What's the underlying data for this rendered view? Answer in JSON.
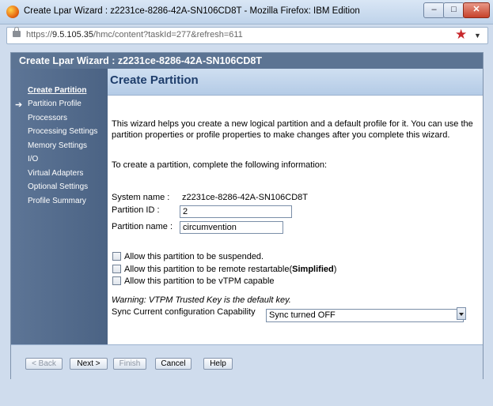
{
  "window": {
    "title": "Create Lpar Wizard : z2231ce-8286-42A-SN106CD8T - Mozilla Firefox: IBM Edition",
    "controls": {
      "minimize": "–",
      "maximize": "□",
      "close": "✕"
    }
  },
  "browser": {
    "url_prefix": "https://",
    "url_host": "9.5.105.35",
    "url_path": "/hmc/content?taskId=277&refresh=611"
  },
  "dialog": {
    "title": "Create Lpar Wizard : z2231ce-8286-42A-SN106CD8T"
  },
  "sidebar": {
    "items": [
      {
        "label": "Create Partition",
        "active": true
      },
      {
        "label": "Partition Profile"
      },
      {
        "label": "Processors"
      },
      {
        "label": "Processing Settings"
      },
      {
        "label": "Memory Settings"
      },
      {
        "label": "I/O"
      },
      {
        "label": "Virtual Adapters"
      },
      {
        "label": "Optional Settings"
      },
      {
        "label": "Profile Summary"
      }
    ]
  },
  "content": {
    "title": "Create Partition",
    "intro": "This wizard helps you create a new logical partition and a default profile for it. You can use the partition properties or profile properties to make changes after you complete this wizard.",
    "instruction": "To create a partition, complete the following information:",
    "system_name_label": "System name :",
    "system_name_value": "z2231ce-8286-42A-SN106CD8T",
    "partition_id_label": "Partition ID :",
    "partition_id_value": "2",
    "partition_name_label": "Partition name :",
    "partition_name_value": "circumvention",
    "checkboxes": {
      "suspend": "Allow this partition to be suspended.",
      "restart_prefix": "Allow this partition to be remote restartable(",
      "restart_bold": "Simplified",
      "restart_suffix": ")",
      "vtpm": "Allow this partition to be vTPM capable"
    },
    "warning": "Warning: VTPM Trusted Key is the default key.",
    "sync_label": "Sync Current configuration Capability",
    "sync_value": "Sync turned OFF"
  },
  "footer": {
    "back": "< Back",
    "next": "Next >",
    "finish": "Finish",
    "cancel": "Cancel",
    "help": "Help"
  }
}
